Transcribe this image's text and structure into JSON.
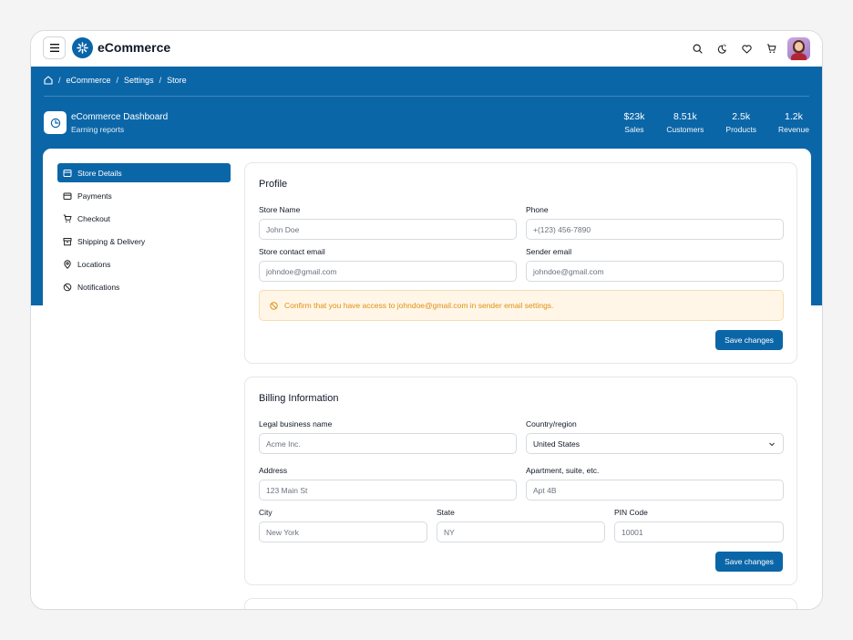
{
  "app": {
    "title": "eCommerce"
  },
  "breadcrumb": [
    "eCommerce",
    "Settings",
    "Store"
  ],
  "dashboard": {
    "title": "eCommerce Dashboard",
    "subtitle": "Earning reports"
  },
  "stats": [
    {
      "value": "$23k",
      "label": "Sales"
    },
    {
      "value": "8.51k",
      "label": "Customers"
    },
    {
      "value": "2.5k",
      "label": "Products"
    },
    {
      "value": "1.2k",
      "label": "Revenue"
    }
  ],
  "sidebar": {
    "items": [
      {
        "label": "Store Details",
        "icon": "store-icon",
        "active": true
      },
      {
        "label": "Payments",
        "icon": "credit-card-icon"
      },
      {
        "label": "Checkout",
        "icon": "cart-icon"
      },
      {
        "label": "Shipping & Delivery",
        "icon": "package-icon"
      },
      {
        "label": "Locations",
        "icon": "map-pin-icon"
      },
      {
        "label": "Notifications",
        "icon": "bell-icon"
      }
    ]
  },
  "profile": {
    "title": "Profile",
    "store_name": {
      "label": "Store Name",
      "placeholder": "John Doe"
    },
    "phone": {
      "label": "Phone",
      "placeholder": "+(123) 456-7890"
    },
    "contact_email": {
      "label": "Store contact email",
      "placeholder": "johndoe@gmail.com"
    },
    "sender_email": {
      "label": "Sender email",
      "placeholder": "johndoe@gmail.com"
    },
    "alert": "Confirm that you have access to johndoe@gmail.com in sender email settings.",
    "save_label": "Save changes"
  },
  "billing": {
    "title": "Billing Information",
    "business_name": {
      "label": "Legal business name",
      "placeholder": "Acme Inc."
    },
    "country": {
      "label": "Country/region",
      "value": "United States"
    },
    "address": {
      "label": "Address",
      "placeholder": "123 Main St"
    },
    "apartment": {
      "label": "Apartment, suite, etc.",
      "placeholder": "Apt 4B"
    },
    "city": {
      "label": "City",
      "placeholder": "New York"
    },
    "state": {
      "label": "State",
      "placeholder": "NY"
    },
    "pin": {
      "label": "PIN Code",
      "placeholder": "10001"
    },
    "save_label": "Save changes"
  },
  "colors": {
    "primary": "#0b66a8",
    "alert_bg": "#fff6e8",
    "alert_text": "#e0900f"
  }
}
